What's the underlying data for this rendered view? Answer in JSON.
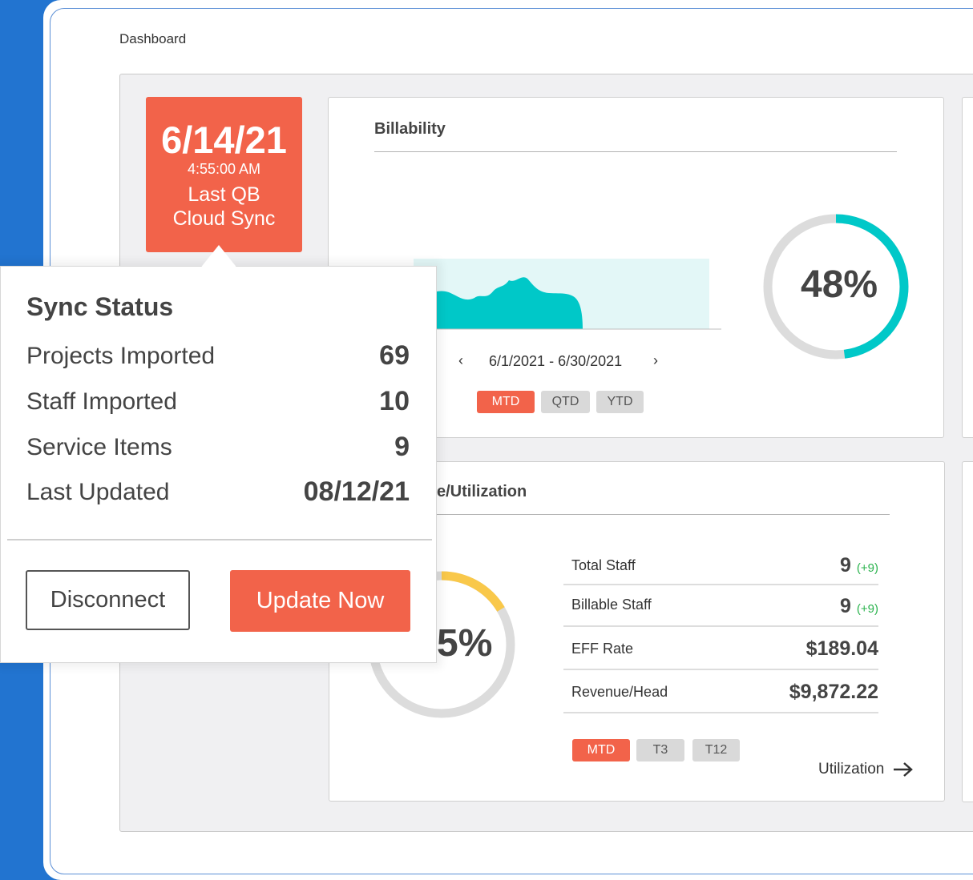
{
  "page": {
    "title": "Dashboard"
  },
  "sync_badge": {
    "date": "6/14/21",
    "time": "4:55:00 AM",
    "label_line1": "Last QB",
    "label_line2": "Cloud Sync"
  },
  "billability": {
    "title": "Billability",
    "date_range": "6/1/2021 - 6/30/2021",
    "prev_icon": "chevron-left-icon",
    "next_icon": "chevron-right-icon",
    "percent_label": "48%",
    "percent_value": 48,
    "tabs": [
      {
        "label": "MTD",
        "active": true
      },
      {
        "label": "QTD",
        "active": false
      },
      {
        "label": "YTD",
        "active": false
      }
    ],
    "colors": {
      "accent": "#00c8c8",
      "area_bg": "#e3f7f7",
      "ring_bg": "#dcdcdc"
    }
  },
  "utilization": {
    "title_visible": "e/Utilization",
    "percent_label_visible": "5%",
    "stats": [
      {
        "label": "Total Staff",
        "value": "9",
        "delta": "(+9)"
      },
      {
        "label": "Billable Staff",
        "value": "9",
        "delta": "(+9)"
      },
      {
        "label": "EFF Rate",
        "value": "$189.04",
        "delta": ""
      },
      {
        "label": "Revenue/Head",
        "value": "$9,872.22",
        "delta": ""
      }
    ],
    "tabs": [
      {
        "label": "MTD",
        "active": true
      },
      {
        "label": "T3",
        "active": false
      },
      {
        "label": "T12",
        "active": false
      }
    ],
    "link_label": "Utilization",
    "link_icon": "arrow-right-icon",
    "colors": {
      "accent": "#f9c84a",
      "ring_bg": "#dcdcdc"
    }
  },
  "sync_status": {
    "title": "Sync Status",
    "rows": [
      {
        "label": "Projects Imported",
        "value": "69"
      },
      {
        "label": "Staff Imported",
        "value": "10"
      },
      {
        "label": "Service Items",
        "value": "9"
      },
      {
        "label": "Last Updated",
        "value": "08/12/21"
      }
    ],
    "disconnect_label": "Disconnect",
    "update_label": "Update Now"
  },
  "colors": {
    "brand": "#f2634a",
    "background": "#2274d0"
  }
}
